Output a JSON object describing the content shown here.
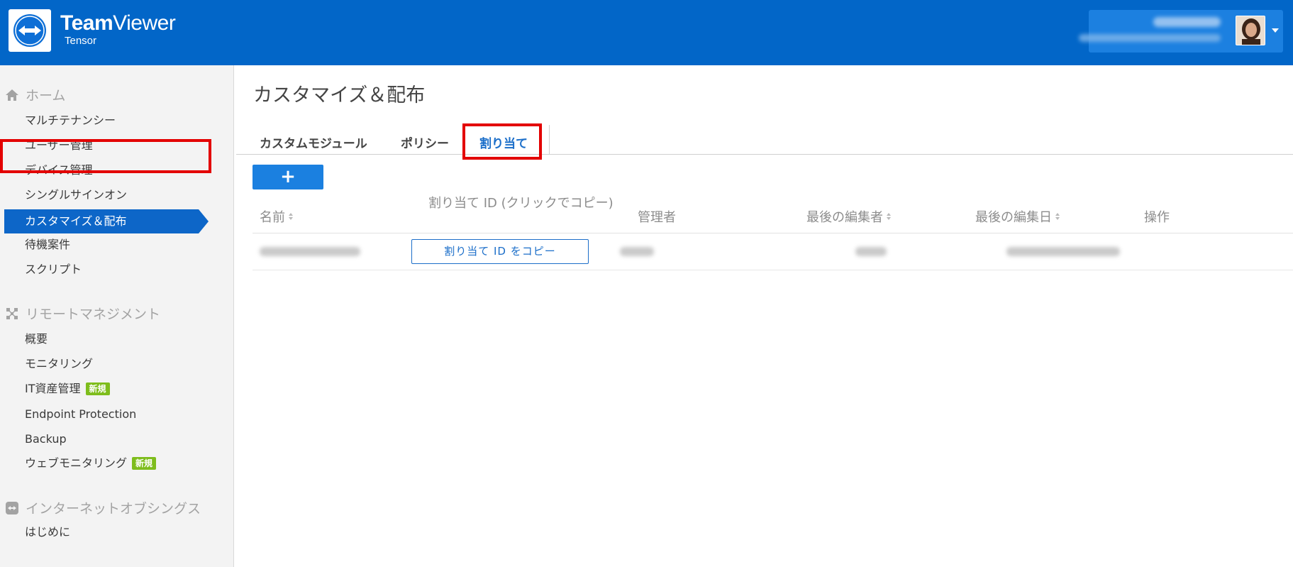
{
  "header": {
    "brand_bold": "Team",
    "brand_light": "Viewer",
    "brand_sub": "Tensor",
    "logo_icon": "teamviewer-arrows-icon",
    "account_avatar_icon": "user-avatar",
    "account_menu_icon": "caret-down-icon"
  },
  "sidebar": {
    "home": {
      "label": "ホーム",
      "icon": "home-icon",
      "items": [
        "マルチテナンシー",
        "ユーザー管理",
        "デバイス管理",
        "シングルサインオン",
        "カスタマイズ＆配布",
        "待機案件",
        "スクリプト"
      ]
    },
    "remote": {
      "label": "リモートマネジメント",
      "icon": "remote-management-icon",
      "items": [
        "概要",
        "モニタリング",
        "IT資産管理",
        "Endpoint Protection",
        "Backup",
        "ウェブモニタリング"
      ],
      "badge": "新規"
    },
    "iot": {
      "label": "インターネットオブシングス",
      "icon": "iot-icon",
      "items": [
        "はじめに"
      ]
    },
    "active_index": 4
  },
  "main": {
    "title": "カスタマイズ＆配布",
    "tabs": [
      {
        "label": "カスタムモジュール",
        "active": false
      },
      {
        "label": "ポリシー",
        "active": false
      },
      {
        "label": "割り当て",
        "active": true
      }
    ],
    "add_button": "+",
    "table": {
      "columns": [
        "名前",
        "割り当て ID (クリックでコピー)",
        "管理者",
        "最後の編集者",
        "最後の編集日",
        "操作"
      ],
      "copy_button": "割り当て ID をコピー"
    }
  },
  "colors": {
    "header_bg": "#0266c8",
    "accent": "#1b80e0",
    "active_nav": "#0d66c8",
    "highlight": "#e30000",
    "badge": "#7ebd1c"
  }
}
